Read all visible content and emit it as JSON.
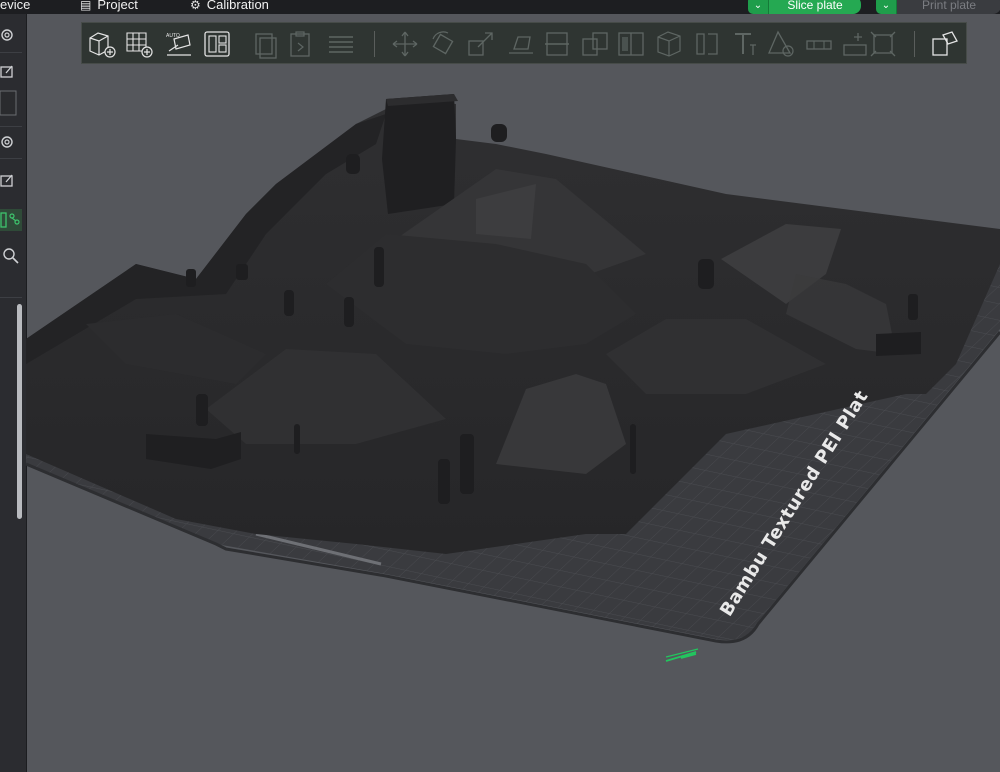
{
  "topbar": {
    "tabs": [
      {
        "label": "evice",
        "icon": "device-icon"
      },
      {
        "label": "Project",
        "icon": "project-icon"
      },
      {
        "label": "Calibration",
        "icon": "gear-icon"
      }
    ],
    "slice_button": "Slice plate",
    "print_button": "Print plate"
  },
  "toolbar": {
    "icons": [
      "add-object-icon",
      "add-plate-icon",
      "auto-arrange-icon",
      "layout-plates-icon",
      "copy-icon",
      "paste-icon",
      "layers-icon",
      "move-icon",
      "rotate-icon",
      "scale-icon",
      "lay-on-face-icon",
      "cut-icon",
      "split-icon",
      "mesh-boolean-icon",
      "support-paint-icon",
      "seam-paint-icon",
      "text-icon",
      "measure-icon",
      "assembly-icon",
      "brim-ear-icon",
      "fit-icon",
      "assemble-icon"
    ]
  },
  "sidebar": {
    "icons": [
      "settings-icon",
      "edit-icon",
      "color-swatch",
      "settings-icon",
      "edit-icon",
      "objects-icon",
      "search-icon"
    ]
  },
  "viewport": {
    "plate_label": "Bambu Textured PEI Plat",
    "colors": {
      "background": "#55575c",
      "plate": "#3b3c40",
      "model": "#2a2a2c",
      "axis": "#22c55e"
    }
  }
}
